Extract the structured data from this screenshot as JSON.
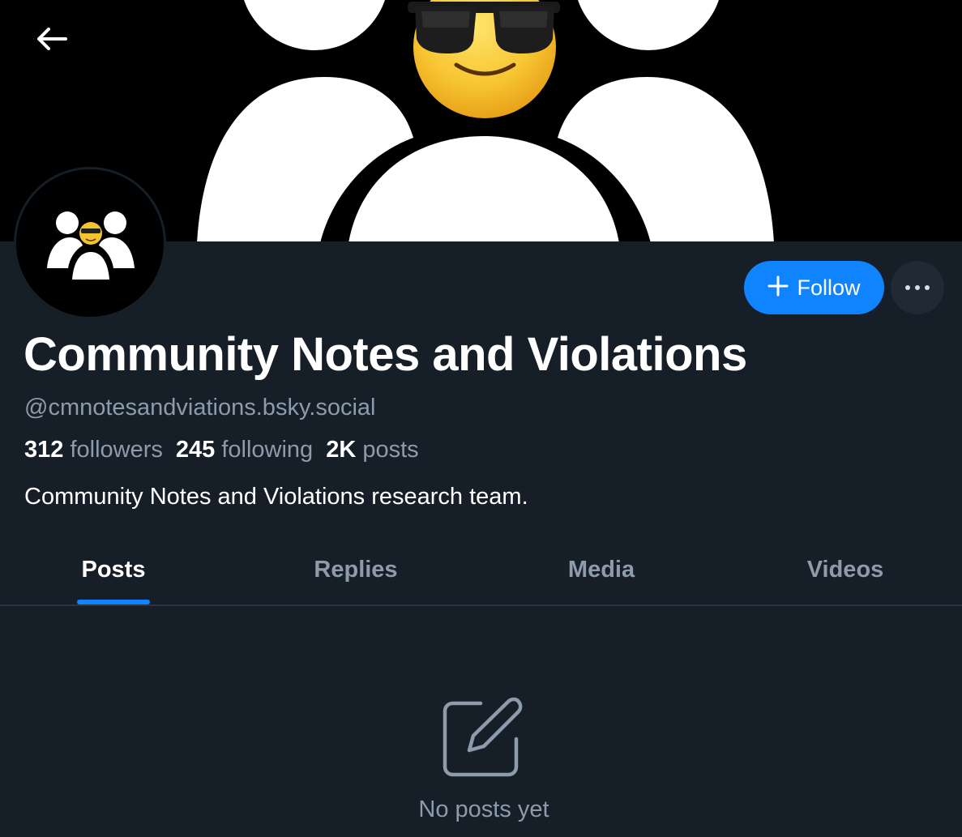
{
  "header": {
    "back_icon": "arrow-left-icon"
  },
  "profile": {
    "display_name": "Community Notes and Violations",
    "handle": "@cmnotesandviations.bsky.social",
    "stats": {
      "followers_count": "312",
      "followers_label": "followers",
      "following_count": "245",
      "following_label": "following",
      "posts_count": "2K",
      "posts_label": "posts"
    },
    "bio": "Community Notes and Violations research team."
  },
  "actions": {
    "follow_label": "Follow",
    "follow_icon": "plus-icon",
    "more_icon": "ellipsis-icon"
  },
  "tabs": [
    {
      "label": "Posts",
      "active": true
    },
    {
      "label": "Replies",
      "active": false
    },
    {
      "label": "Media",
      "active": false
    },
    {
      "label": "Videos",
      "active": false
    }
  ],
  "empty_state": {
    "icon": "compose-icon",
    "text": "No posts yet"
  },
  "colors": {
    "background": "#161e27",
    "accent": "#1083fe",
    "muted_text": "#8d9bac",
    "divider": "#2a3541"
  }
}
